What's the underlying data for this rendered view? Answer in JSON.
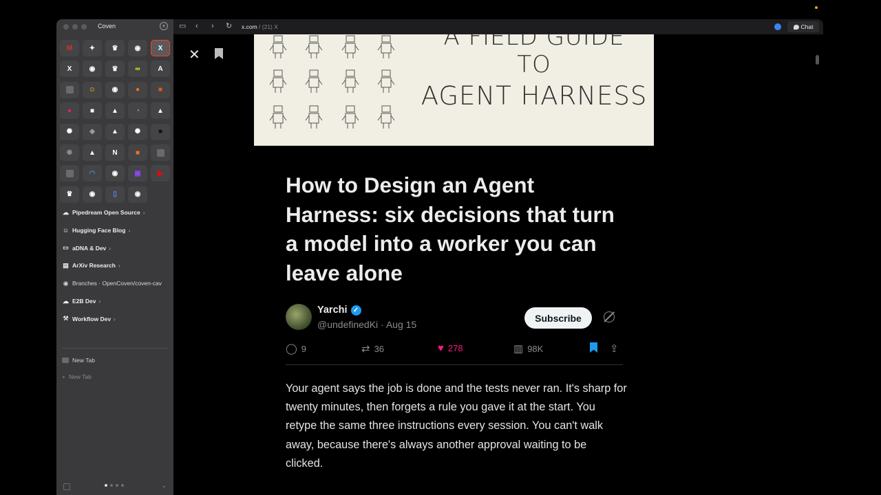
{
  "sidebar": {
    "title": "Coven",
    "grid_tiles": [
      {
        "icon": "gmail-icon",
        "glyph": "M",
        "color": "#d93025"
      },
      {
        "icon": "brain-app-icon",
        "glyph": "✦",
        "color": "#ffffff"
      },
      {
        "icon": "crown-app-icon",
        "glyph": "♛",
        "color": "#ffffff"
      },
      {
        "icon": "github-icon",
        "glyph": "◉",
        "color": "#ffffff"
      },
      {
        "icon": "x-icon",
        "glyph": "X",
        "color": "#ffffff"
      },
      {
        "icon": "x-icon",
        "glyph": "X",
        "color": "#ffffff"
      },
      {
        "icon": "github-icon",
        "glyph": "◉",
        "color": "#ffffff"
      },
      {
        "icon": "crown-app-icon",
        "glyph": "♛",
        "color": "#ffffff"
      },
      {
        "icon": "loop-app-icon",
        "glyph": "∞",
        "color": "#e6ff00"
      },
      {
        "icon": "anthropic-icon",
        "glyph": "A",
        "color": "#ffffff"
      },
      {
        "icon": "blank-app-icon",
        "glyph": "",
        "color": "#6a6a6c"
      },
      {
        "icon": "hugging-face-icon",
        "glyph": "☺",
        "color": "#ffcc00"
      },
      {
        "icon": "github-icon",
        "glyph": "◉",
        "color": "#ffffff"
      },
      {
        "icon": "orange-circle-app-icon",
        "glyph": "●",
        "color": "#ff6a2b"
      },
      {
        "icon": "orange-square-app-icon",
        "glyph": "■",
        "color": "#e05a1a"
      },
      {
        "icon": "red-dot-app-icon",
        "glyph": "●",
        "color": "#e0245e"
      },
      {
        "icon": "white-square-app-icon",
        "glyph": "■",
        "color": "#ffffff"
      },
      {
        "icon": "triangle-app-icon",
        "glyph": "▲",
        "color": "#ffffff"
      },
      {
        "icon": "pie-app-icon",
        "glyph": "◔",
        "color": "#9a9a9a"
      },
      {
        "icon": "triangle-app-icon",
        "glyph": "▲",
        "color": "#ffffff"
      },
      {
        "icon": "openai-icon",
        "glyph": "✺",
        "color": "#ffffff"
      },
      {
        "icon": "drop-app-icon",
        "glyph": "◆",
        "color": "#9a9a9a"
      },
      {
        "icon": "triangle-app-icon",
        "glyph": "▲",
        "color": "#ffffff"
      },
      {
        "icon": "openai-icon",
        "glyph": "✺",
        "color": "#ffffff"
      },
      {
        "icon": "black-square-app-icon",
        "glyph": "■",
        "color": "#111111"
      },
      {
        "icon": "openai-dim-icon",
        "glyph": "✺",
        "color": "#8a8a8a"
      },
      {
        "icon": "triangle-app-icon",
        "glyph": "▲",
        "color": "#ffffff"
      },
      {
        "icon": "notion-icon",
        "glyph": "N",
        "color": "#ffffff"
      },
      {
        "icon": "orange-box-app-icon",
        "glyph": "■",
        "color": "#ff6a2b"
      },
      {
        "icon": "blank-app-icon",
        "glyph": "",
        "color": "#6a6a6c"
      },
      {
        "icon": "blank-app-icon",
        "glyph": "",
        "color": "#6a6a6c"
      },
      {
        "icon": "arc-app-icon",
        "glyph": "◠",
        "color": "#4b8bff"
      },
      {
        "icon": "github-icon",
        "glyph": "◉",
        "color": "#ffffff"
      },
      {
        "icon": "twitch-icon",
        "glyph": "▣",
        "color": "#9146ff"
      },
      {
        "icon": "youtube-icon",
        "glyph": "▶",
        "color": "#ff0000"
      },
      {
        "icon": "crown-app-icon",
        "glyph": "♛",
        "color": "#ffffff"
      },
      {
        "icon": "github-icon",
        "glyph": "◉",
        "color": "#ffffff"
      },
      {
        "icon": "blue-app-icon",
        "glyph": "▯",
        "color": "#4b8bff"
      },
      {
        "icon": "github-icon",
        "glyph": "◉",
        "color": "#ffffff"
      }
    ],
    "folders": [
      {
        "label": "Pipedream Open Source",
        "icon": "cloud-icon",
        "glyph": "☁",
        "chevron": true
      },
      {
        "label": "Hugging Face Blog",
        "icon": "hugging-face-icon",
        "glyph": "☺",
        "chevron": true
      },
      {
        "label": "aDNA & Dev",
        "icon": "laptop-icon",
        "glyph": "▭",
        "chevron": true
      },
      {
        "label": "ArXiv Research",
        "icon": "books-icon",
        "glyph": "▤",
        "chevron": true
      },
      {
        "label": "Branches · OpenCoven/coven-cav",
        "icon": "github-icon",
        "glyph": "◉",
        "chevron": false
      },
      {
        "label": "E2B Dev",
        "icon": "cloud-icon",
        "glyph": "☁",
        "chevron": true
      },
      {
        "label": "Workflow Dev",
        "icon": "tools-icon",
        "glyph": "⚒",
        "chevron": true
      }
    ],
    "new_tab_label": "New Tab",
    "new_tab_add_label": "New Tab"
  },
  "browser": {
    "url_host": "x.com",
    "url_rest": " / (21) X",
    "chat_label": "Chat"
  },
  "hero": {
    "line1": "A FIELD GUIDE",
    "line2": "TO",
    "line3": "AGENT HARNESS"
  },
  "article": {
    "title": "How to Design an Agent Harness: six decisions that turn a model into a worker you can leave alone",
    "author_name": "Yarchi",
    "author_handle": "@undefinedKi · Aug 15",
    "subscribe_label": "Subscribe",
    "replies": "9",
    "reposts": "36",
    "likes": "278",
    "views": "98K",
    "body": "Your agent says the job is done and the tests never ran. It's sharp for twenty minutes, then forgets a rule you gave it at the start. You retype the same three instructions every session. You can't walk away, because there's always another approval waiting to be clicked."
  },
  "colors": {
    "like": "#f91880",
    "verified": "#1d9bf0",
    "bookmark": "#1d9bf0"
  }
}
